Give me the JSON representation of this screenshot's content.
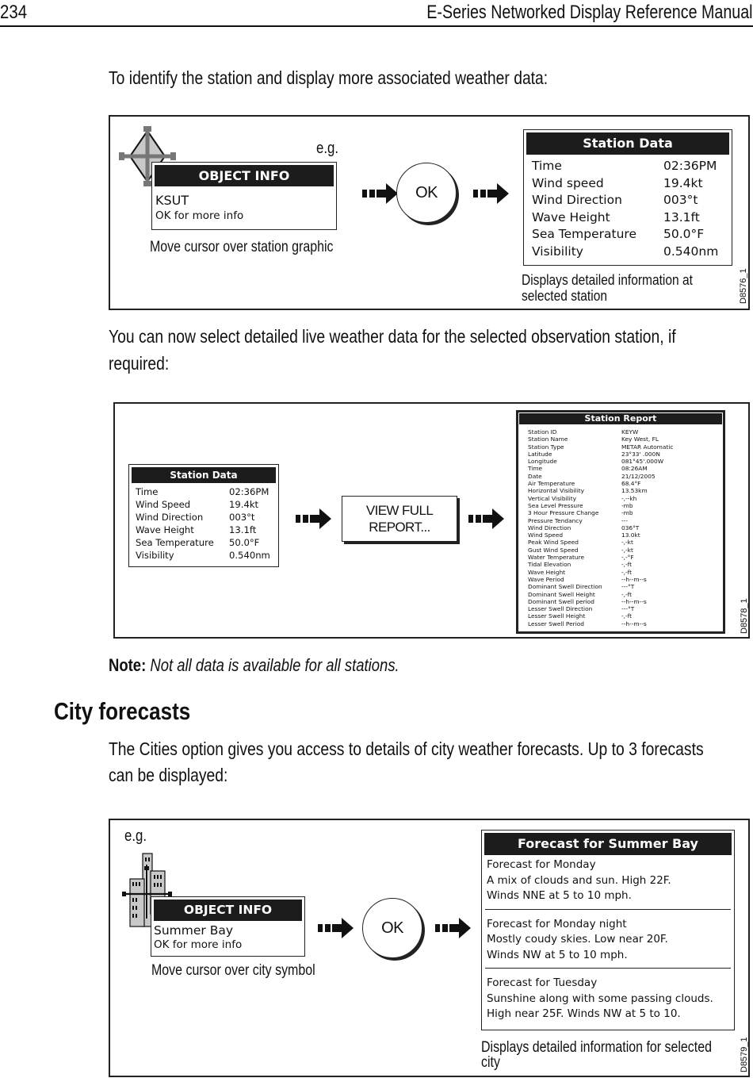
{
  "header": {
    "page_number": "234",
    "manual_title": "E-Series Networked Display Reference Manual"
  },
  "intro_text": "To identify the station and display more associated weather data:",
  "figure1": {
    "eg_label": "e.g.",
    "object_info": {
      "title": "OBJECT INFO",
      "name": "KSUT",
      "hint": "OK for more info"
    },
    "cursor_caption": "Move cursor over station graphic",
    "ok_label": "OK",
    "station_data": {
      "title": "Station Data",
      "rows": [
        {
          "label": "Time",
          "value": "02:36PM"
        },
        {
          "label": "Wind speed",
          "value": "19.4kt"
        },
        {
          "label": "Wind Direction",
          "value": "003°t"
        },
        {
          "label": "Wave Height",
          "value": "13.1ft"
        },
        {
          "label": "Sea Temperature",
          "value": "50.0°F"
        },
        {
          "label": "Visibility",
          "value": "0.540nm"
        }
      ]
    },
    "result_caption_line1": "Displays detailed information at",
    "result_caption_line2": "selected station",
    "figure_code": "D8576_1"
  },
  "select_text_line1": "You can now select detailed live weather data for the selected observation station, if",
  "select_text_line2": "required:",
  "figure2": {
    "station_data": {
      "title": "Station Data",
      "rows": [
        {
          "label": "Time",
          "value": "02:36PM"
        },
        {
          "label": "Wind Speed",
          "value": "19.4kt"
        },
        {
          "label": "Wind Direction",
          "value": "003°t"
        },
        {
          "label": "Wave Height",
          "value": "13.1ft"
        },
        {
          "label": "Sea Temperature",
          "value": "50.0°F"
        },
        {
          "label": "Visibility",
          "value": "0.540nm"
        }
      ]
    },
    "view_report_line1": "VIEW FULL",
    "view_report_line2": "REPORT...",
    "station_report": {
      "title": "Station Report",
      "rows": [
        {
          "label": "Station ID",
          "value": "KEYW"
        },
        {
          "label": "Station Name",
          "value": "Key West, FL"
        },
        {
          "label": "Station Type",
          "value": "METAR Automatic"
        },
        {
          "label": "Latitude",
          "value": "23°33' .000N"
        },
        {
          "label": "Longitude",
          "value": "081°45'.000W"
        },
        {
          "label": "Time",
          "value": "08:26AM"
        },
        {
          "label": "Date",
          "value": "21/12/2005"
        },
        {
          "label": "Air Temperature",
          "value": "68.4°F"
        },
        {
          "label": "Horizontal Visibility",
          "value": "13.53km"
        },
        {
          "label": "Vertical Visibility",
          "value": "-,--kh"
        },
        {
          "label": "Sea Level Pressure",
          "value": "-mb"
        },
        {
          "label": "3 Hour Pressure Change",
          "value": "-mb"
        },
        {
          "label": "Pressure Tendancy",
          "value": "---"
        },
        {
          "label": "Wind Direction",
          "value": "036°T"
        },
        {
          "label": "Wind Speed",
          "value": "13.0kt"
        },
        {
          "label": "Peak Wind Speed",
          "value": "-,-kt"
        },
        {
          "label": "Gust Wind Speed",
          "value": "-,-kt"
        },
        {
          "label": "Water Temperature",
          "value": "-,-°F"
        },
        {
          "label": "Tidal Elevation",
          "value": "-,-ft"
        },
        {
          "label": "Wave Height",
          "value": "-,-ft"
        },
        {
          "label": "Wave Period",
          "value": "--h--m--s"
        },
        {
          "label": "Dominant Swell Direction",
          "value": "---°T"
        },
        {
          "label": "Dominant Swell Height",
          "value": "-,-ft"
        },
        {
          "label": "Dominant Swell period",
          "value": "--h--m--s"
        },
        {
          "label": "Lesser Swell Direction",
          "value": "---°T"
        },
        {
          "label": "Lesser Swell Height",
          "value": "-,-ft"
        },
        {
          "label": "Lesser Swell Period",
          "value": "--h--m--s"
        }
      ]
    },
    "figure_code": "D8578_1"
  },
  "note": {
    "label": "Note:",
    "text": "Not all data is available for all stations."
  },
  "city_section": {
    "heading": "City forecasts",
    "text_line1": "The Cities option gives you access to details of city weather forecasts. Up to 3 forecasts",
    "text_line2": "can be displayed:"
  },
  "figure3": {
    "eg_label": "e.g.",
    "object_info": {
      "title": "OBJECT INFO",
      "name": "Summer Bay",
      "hint": "OK for more info"
    },
    "cursor_caption": "Move cursor over city symbol",
    "ok_label": "OK",
    "forecast": {
      "title": "Forecast for Summer Bay",
      "sections": [
        {
          "lines": [
            "Forecast for Monday",
            "A mix of clouds and sun.  High 22F.",
            "Winds NNE at 5 to 10 mph."
          ]
        },
        {
          "lines": [
            "Forecast for Monday night",
            "Mostly coudy skies.  Low near 20F.",
            "Winds NW at 5 to 10 mph."
          ]
        },
        {
          "lines": [
            "Forecast for Tuesday",
            "Sunshine along with some passing clouds.",
            "High near 25F.  Winds NW at 5 to 10."
          ]
        }
      ]
    },
    "result_caption_line1": "Displays detailed information for selected",
    "result_caption_line2": "city",
    "figure_code": "D8579_1"
  }
}
